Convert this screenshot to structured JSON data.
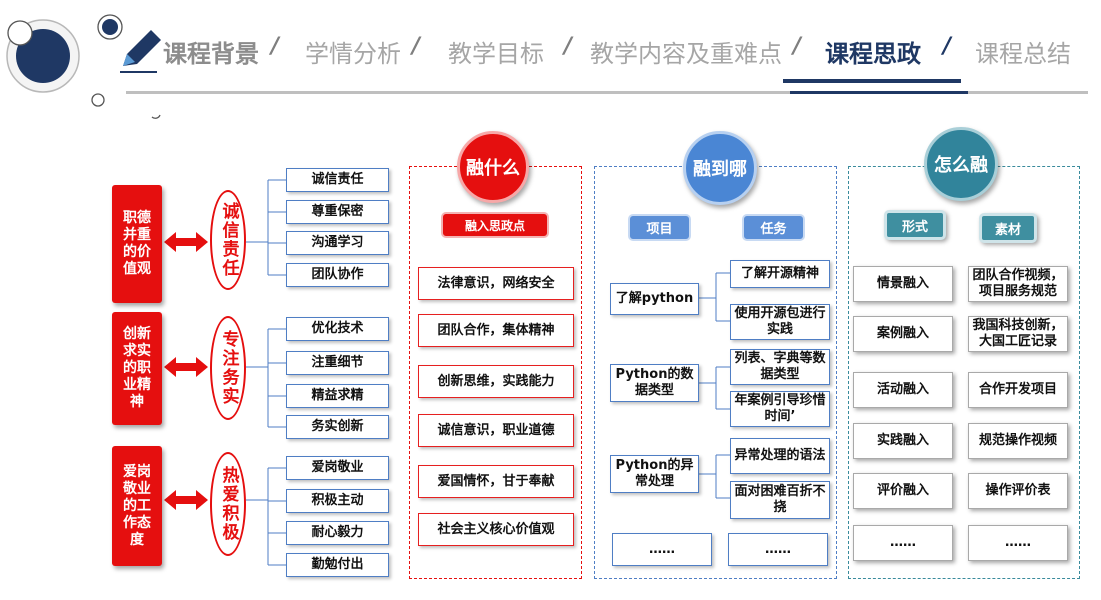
{
  "nav": {
    "tabs": [
      "课程背景",
      "学情分析",
      "教学目标",
      "教学内容及重难点",
      "课程思政",
      "课程总结"
    ],
    "separator": "/",
    "active_index": 4
  },
  "colors": {
    "red": "#e50f0f",
    "blue": "#4f7ec4",
    "teal": "#3a8b9c",
    "navy": "#1f3864"
  },
  "left": {
    "groups": [
      {
        "category": "职德并重的价值观",
        "virtue": "诚信责任",
        "items": [
          "诚信责任",
          "尊重保密",
          "沟通学习",
          "团队协作"
        ]
      },
      {
        "category": "创新求实的职业精神",
        "virtue": "专注务实",
        "items": [
          "优化技术",
          "注重细节",
          "精益求精",
          "务实创新"
        ]
      },
      {
        "category": "爱岗敬业的工作态度",
        "virtue": "热爱积极",
        "items": [
          "爱岗敬业",
          "积极主动",
          "耐心毅力",
          "勤勉付出"
        ]
      }
    ]
  },
  "what": {
    "title": "融什么",
    "subtitle": "融入思政点",
    "items": [
      "法律意识，网络安全",
      "团队合作，集体精神",
      "创新思维，实践能力",
      "诚信意识，职业道德",
      "爱国情怀，甘于奉献",
      "社会主义核心价值观"
    ]
  },
  "where": {
    "title": "融到哪",
    "col1_header": "项目",
    "col2_header": "任务",
    "projects": [
      {
        "name": "了解python",
        "tasks": [
          "了解开源精神",
          "使用开源包进行实践"
        ]
      },
      {
        "name": "Python的数据类型",
        "tasks": [
          "列表、字典等数据类型",
          "年案例引导珍惜时间’"
        ]
      },
      {
        "name": "Python的异常处理",
        "tasks": [
          "异常处理的语法",
          "面对困难百折不挠"
        ]
      }
    ],
    "ellipsis": "……"
  },
  "how": {
    "title": "怎么融",
    "col1_header": "形式",
    "col2_header": "素材",
    "rows": [
      {
        "form": "情景融入",
        "material": "团队合作视频，项目服务规范"
      },
      {
        "form": "案例融入",
        "material": "我国科技创新，大国工匠记录"
      },
      {
        "form": "活动融入",
        "material": "合作开发项目"
      },
      {
        "form": "实践融入",
        "material": "规范操作视频"
      },
      {
        "form": "评价融入",
        "material": "操作评价表"
      }
    ],
    "ellipsis": "……"
  }
}
